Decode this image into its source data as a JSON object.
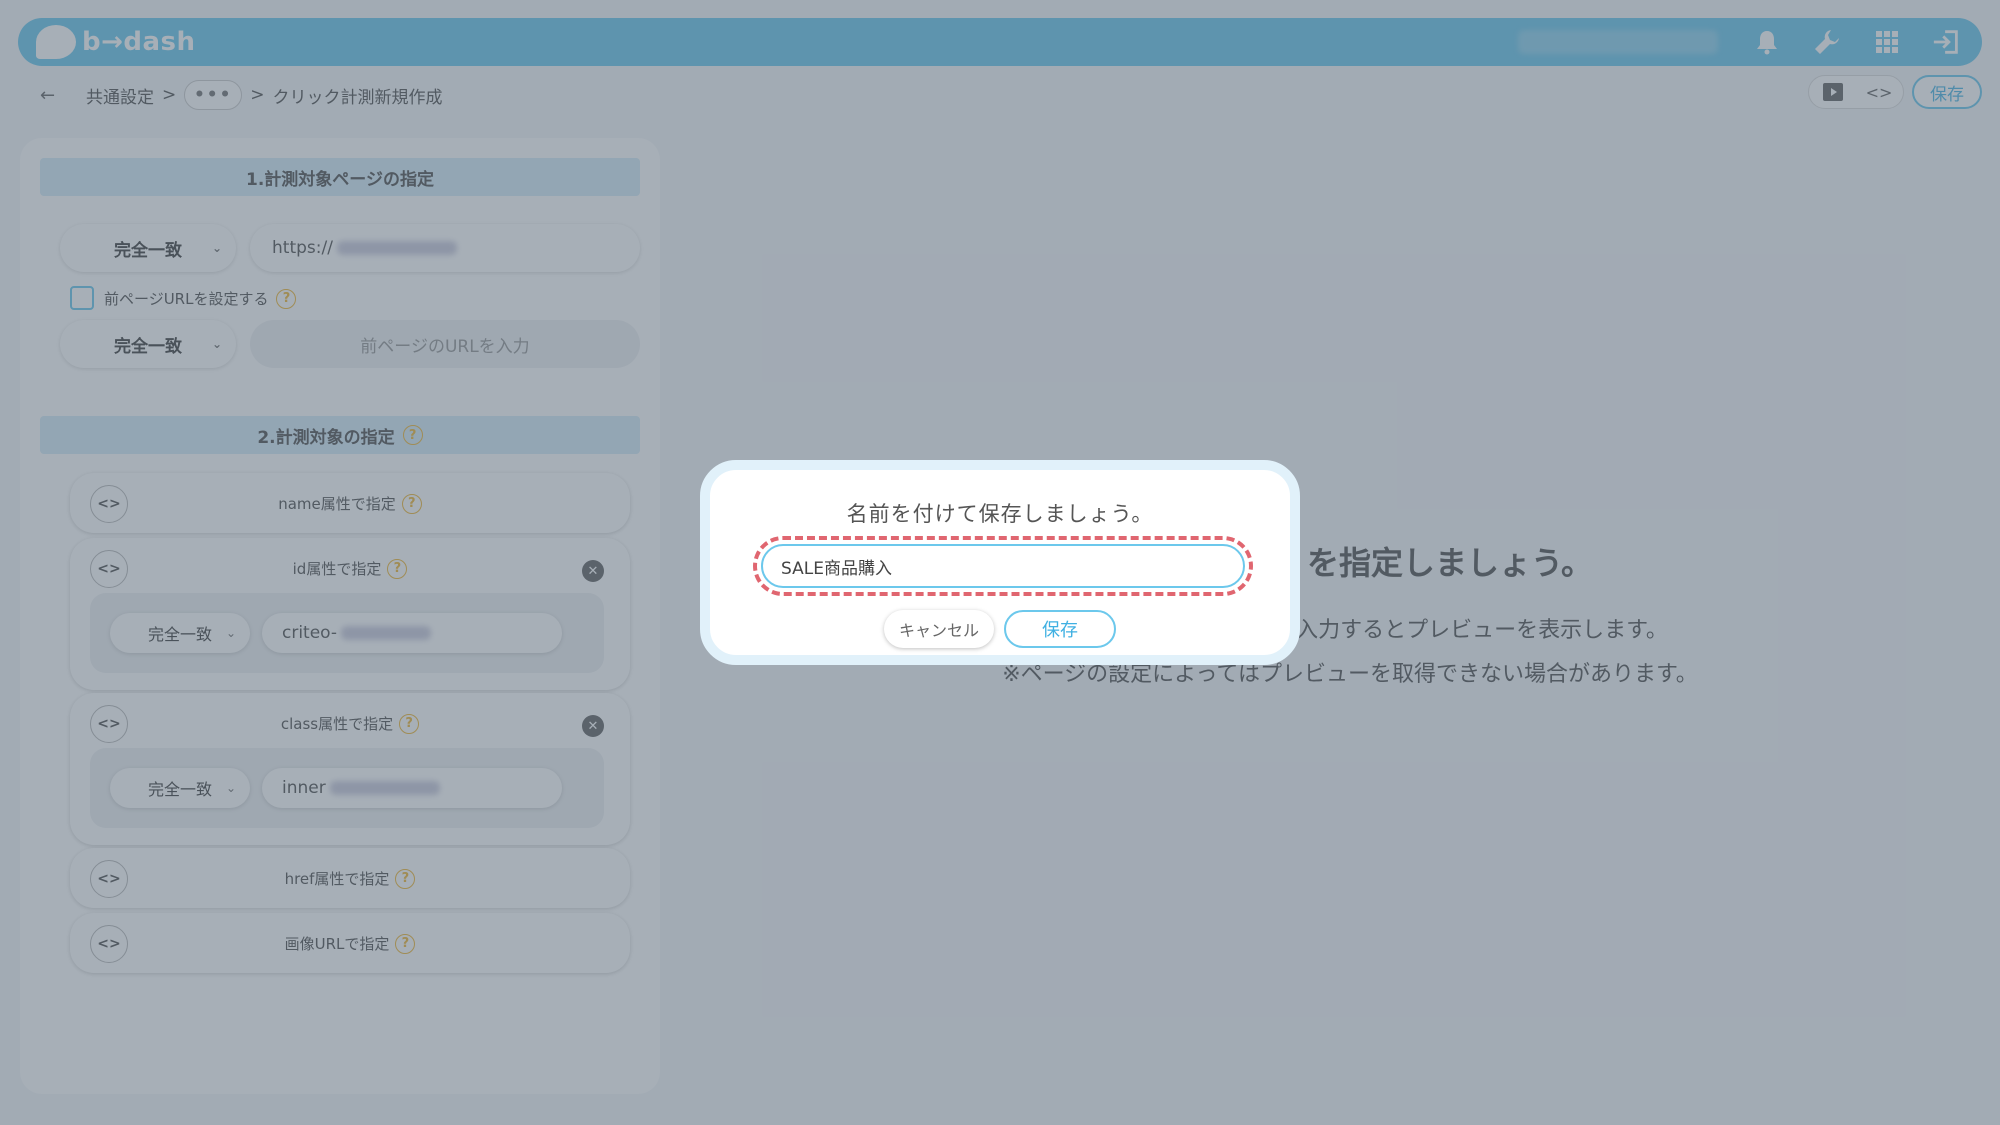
{
  "app": {
    "logo_text": "b→dash"
  },
  "breadcrumb": {
    "back_glyph": "←",
    "root": "共通設定",
    "sep1": ">",
    "ellipsis": "•••",
    "sep2": ">",
    "current": "クリック計測新規作成"
  },
  "toolbar": {
    "save_label": "保存"
  },
  "section1": {
    "title": "1.計測対象ページの指定",
    "match_label": "完全一致",
    "url_value": "https://",
    "prev_url_checkbox_label": "前ページURLを設定する",
    "prev_match_label": "完全一致",
    "prev_url_placeholder": "前ページのURLを入力"
  },
  "section2": {
    "title": "2.計測対象の指定",
    "cards": [
      {
        "label": "name属性で指定"
      },
      {
        "label": "id属性で指定",
        "match_label": "完全一致",
        "value": "criteo-"
      },
      {
        "label": "class属性で指定",
        "match_label": "完全一致",
        "value": "inner"
      },
      {
        "label": "href属性で指定"
      },
      {
        "label": "画像URLで指定"
      }
    ]
  },
  "preview": {
    "title": "を指定しましょう。",
    "line1": "件で入力するとプレビューを表示します。",
    "line2": "※ページの設定によってはプレビューを取得できない場合があります。"
  },
  "modal": {
    "title": "名前を付けて保存しましょう。",
    "input_value": "SALE商品購入",
    "cancel_label": "キャンセル",
    "save_label": "保存"
  },
  "help_glyph": "?",
  "close_glyph": "✕",
  "code_glyph": "<>",
  "colors": {
    "accent": "#6cc8ec",
    "highlight": "#e06670",
    "help": "#f0b93a"
  }
}
